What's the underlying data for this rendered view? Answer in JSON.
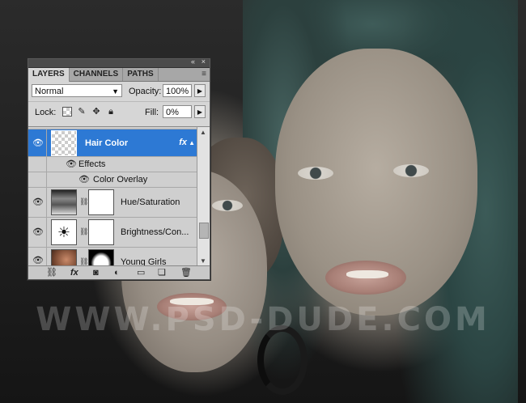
{
  "watermark": "WWW.PSD-DUDE.COM",
  "panel": {
    "collapse_icon": "«",
    "close_icon": "×",
    "tabs": [
      {
        "label": "LAYERS",
        "active": true
      },
      {
        "label": "CHANNELS",
        "active": false
      },
      {
        "label": "PATHS",
        "active": false
      }
    ],
    "menu_icon": "≡",
    "blend_mode": "Normal",
    "opacity_label": "Opacity:",
    "opacity_value": "100%",
    "lock_label": "Lock:",
    "fill_label": "Fill:",
    "fill_value": "0%",
    "layers": [
      {
        "name": "Hair Color",
        "selected": true,
        "fx": "fx",
        "visible": true
      },
      {
        "name": "Effects",
        "type": "effects-header"
      },
      {
        "name": "Color Overlay",
        "type": "effect"
      },
      {
        "name": "Hue/Saturation",
        "type": "adjustment",
        "visible": true
      },
      {
        "name": "Brightness/Con...",
        "type": "adjustment",
        "visible": true
      },
      {
        "name": "Young Girls",
        "type": "image",
        "visible": true
      }
    ],
    "bottom_icons": [
      "link-icon",
      "fx-icon",
      "mask-icon",
      "adjustment-icon",
      "group-icon",
      "new-layer-icon",
      "trash-icon"
    ],
    "colors": {
      "selection": "#2d79d4",
      "panel": "#d6d6d6",
      "title": "#4b4b4b"
    }
  }
}
